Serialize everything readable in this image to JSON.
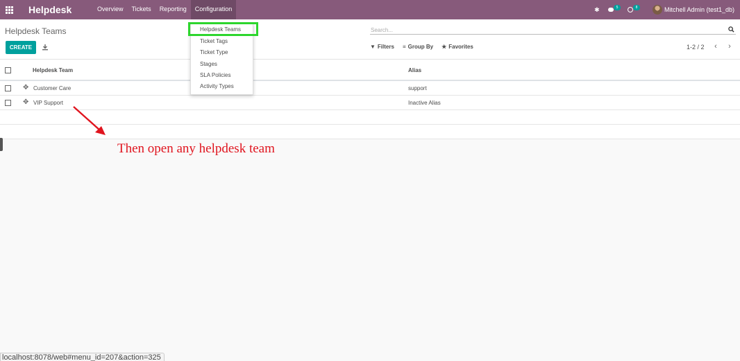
{
  "app": {
    "brand": "Helpdesk"
  },
  "topmenu": [
    {
      "label": "Overview"
    },
    {
      "label": "Tickets"
    },
    {
      "label": "Reporting"
    },
    {
      "label": "Configuration"
    }
  ],
  "systray": {
    "messages_count": "5",
    "activities_count": "8",
    "user": "Mitchell Admin (test1_db)"
  },
  "control_panel": {
    "breadcrumb": "Helpdesk Teams",
    "create_label": "CREATE",
    "search_placeholder": "Search...",
    "filters_label": "Filters",
    "groupby_label": "Group By",
    "favorites_label": "Favorites",
    "pager": "1-2 / 2"
  },
  "list": {
    "columns": [
      "Helpdesk Team",
      "Alias"
    ],
    "rows": [
      {
        "team": "Customer Care",
        "alias": "support"
      },
      {
        "team": "VIP Support",
        "alias": "Inactive Alias"
      }
    ]
  },
  "config_menu": {
    "items": [
      "Helpdesk Teams",
      "Ticket Tags",
      "Ticket Type",
      "Stages",
      "SLA Policies",
      "Activity Types"
    ]
  },
  "annotation": {
    "text": "Then open any helpdesk team"
  },
  "statusbar": {
    "url": "localhost:8078/web#menu_id=207&action=325"
  },
  "colors": {
    "navbar": "#875a7b",
    "primary": "#00a09d",
    "highlight": "#2dd62d",
    "annotation": "#e0141e"
  }
}
